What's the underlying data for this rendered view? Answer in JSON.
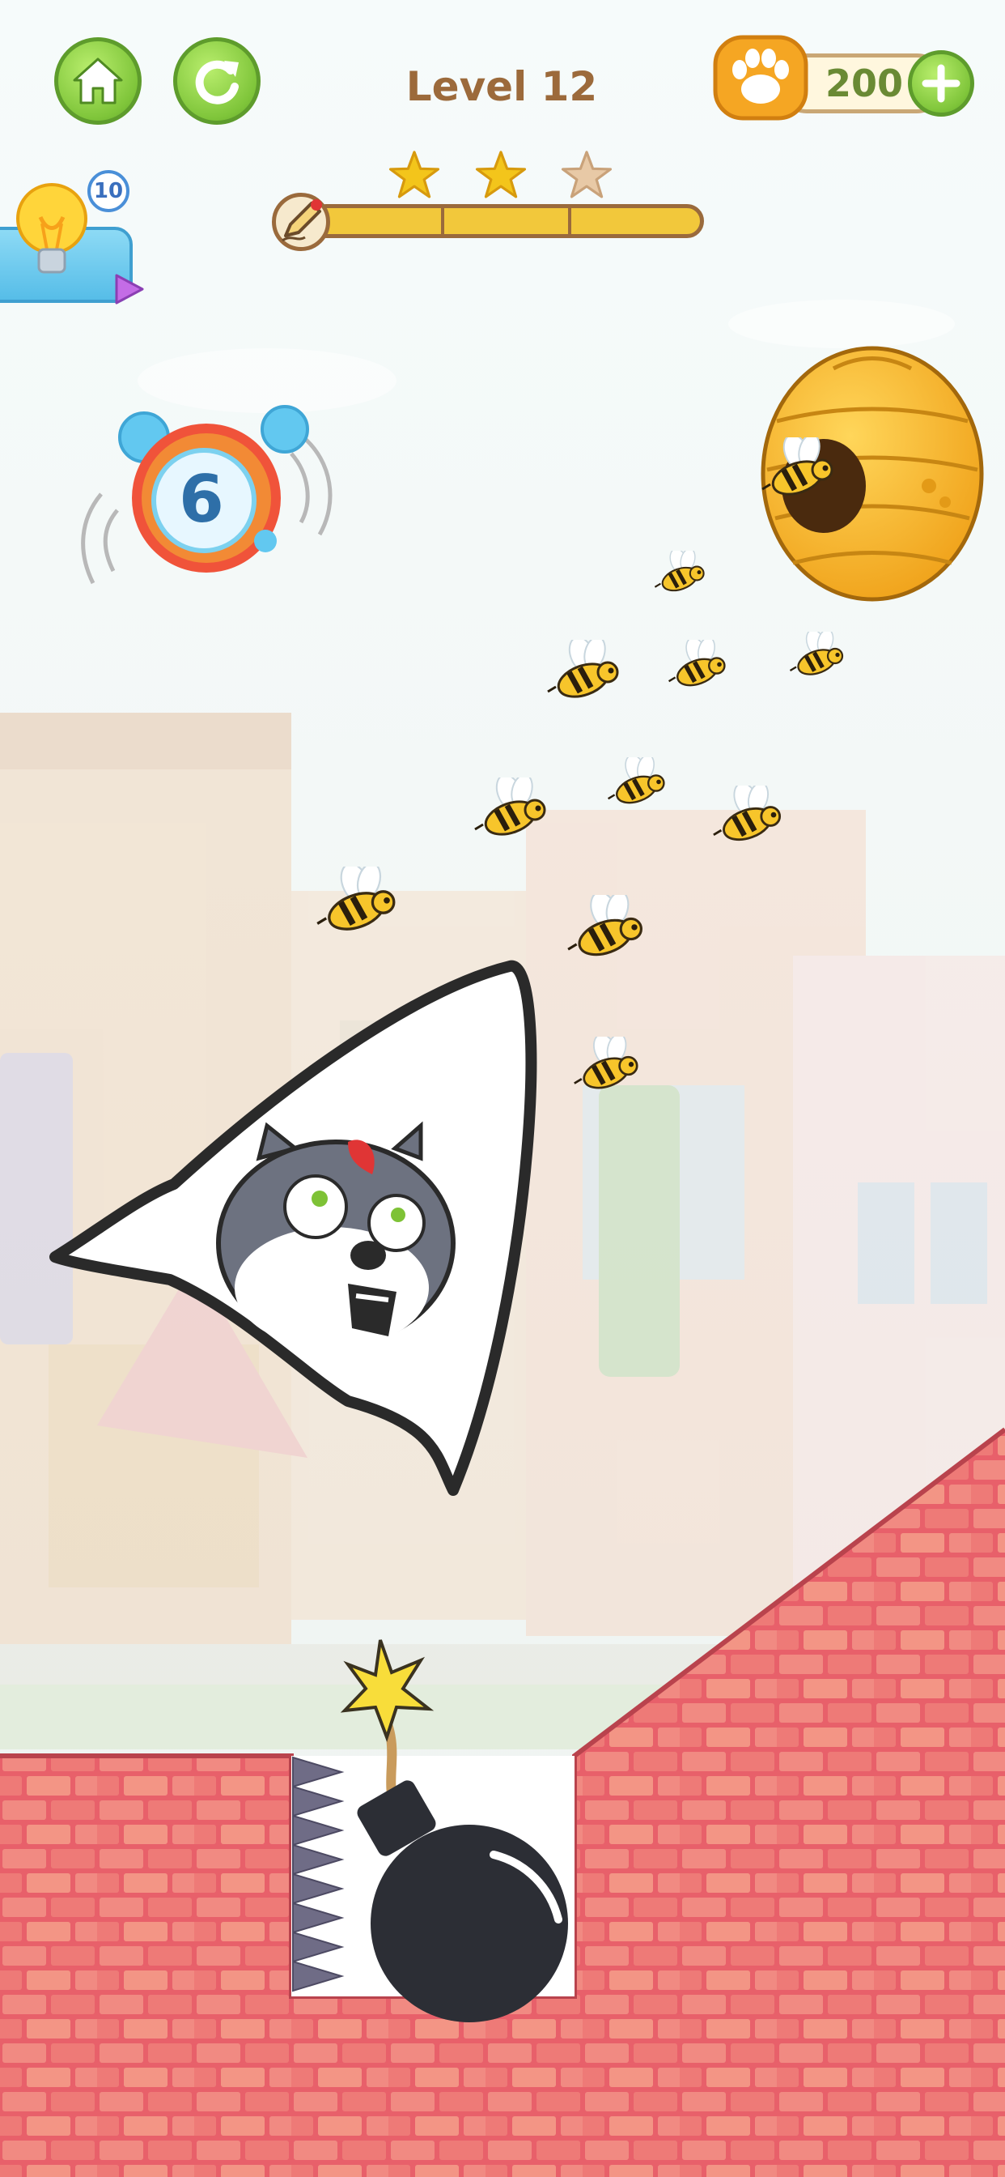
{
  "hud": {
    "level_title": "Level 12",
    "coins": "200",
    "hint_count": "10",
    "stars_earned": 2,
    "stars_total": 3,
    "ink_remaining_fraction": 1.0
  },
  "timer": {
    "value": "6"
  },
  "icons": {
    "home": "home-icon",
    "restart": "restart-icon",
    "paw_coin": "paw-icon",
    "add": "plus-icon",
    "hint": "lightbulb-icon",
    "play_ad": "play-icon",
    "pencil": "pencil-icon",
    "star": "star-icon",
    "alarm": "alarm-clock-icon",
    "beehive": "beehive-icon",
    "bee": "bee-icon",
    "bomb": "bomb-icon"
  },
  "colors": {
    "button_green": "#7fc53a",
    "title_brown": "#9c6a3b",
    "coin_text": "#6a8a34",
    "star_gold": "#f3c51b",
    "star_empty": "#e8c9a6",
    "brick": "#e8606a",
    "bomb": "#2c2e35"
  }
}
